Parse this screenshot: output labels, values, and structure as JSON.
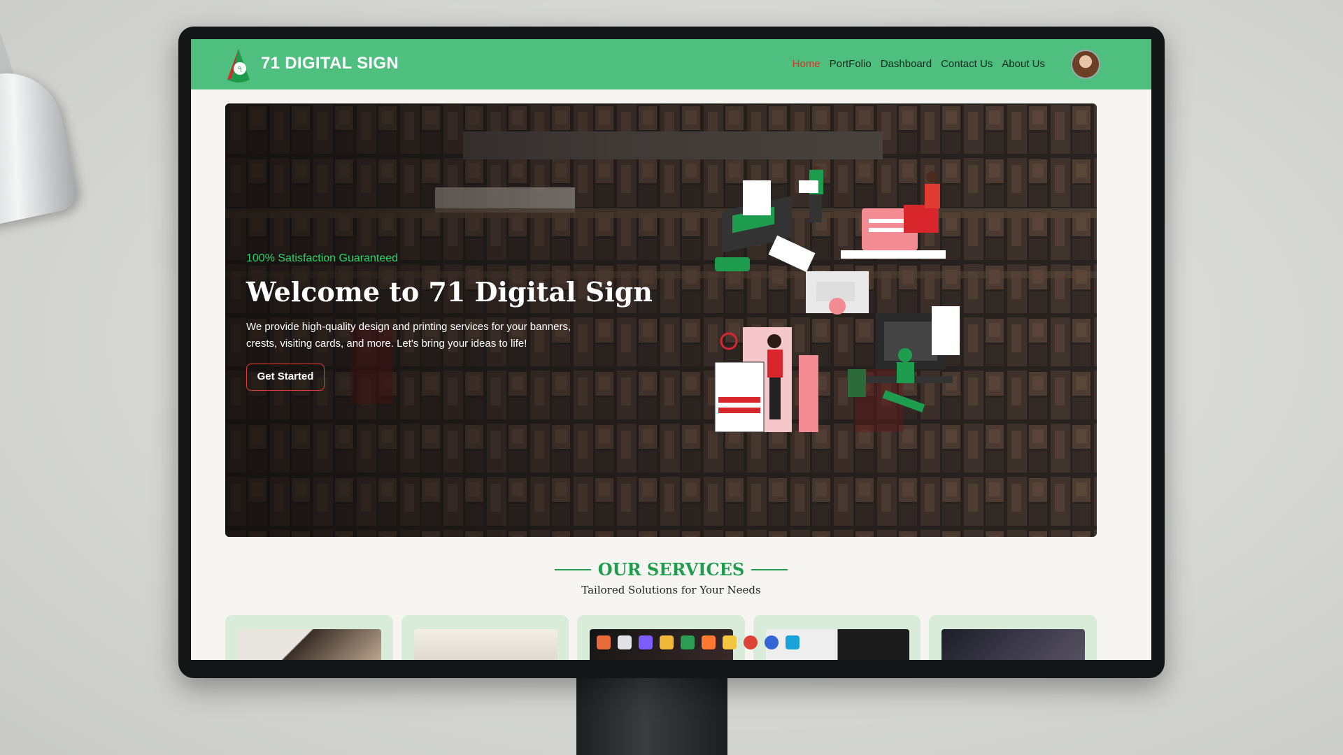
{
  "header": {
    "brand": "71 DIGITAL SIGN",
    "nav": [
      "Home",
      "PortFolio",
      "Dashboard",
      "Contact Us",
      "About Us"
    ],
    "active_nav": "Home",
    "header_color": "#4fbf80"
  },
  "hero": {
    "tagline": "100% Satisfaction Guaranteed",
    "title": "Welcome to 71 Digital Sign",
    "text": "We provide high-quality design and printing services for your banners, crests, visiting cards, and more. Let's bring your ideas to life!",
    "cta": "Get Started"
  },
  "services": {
    "title": "OUR SERVICES",
    "subtitle": "Tailored Solutions for Your Needs",
    "card_count": 5
  },
  "colors": {
    "accent_green": "#1f9d4f",
    "accent_red": "#d93025",
    "page_background": "#f6f5f1"
  },
  "icons": [
    "logo-icon",
    "avatar",
    "printer-illustration",
    "taskbar-icons"
  ]
}
